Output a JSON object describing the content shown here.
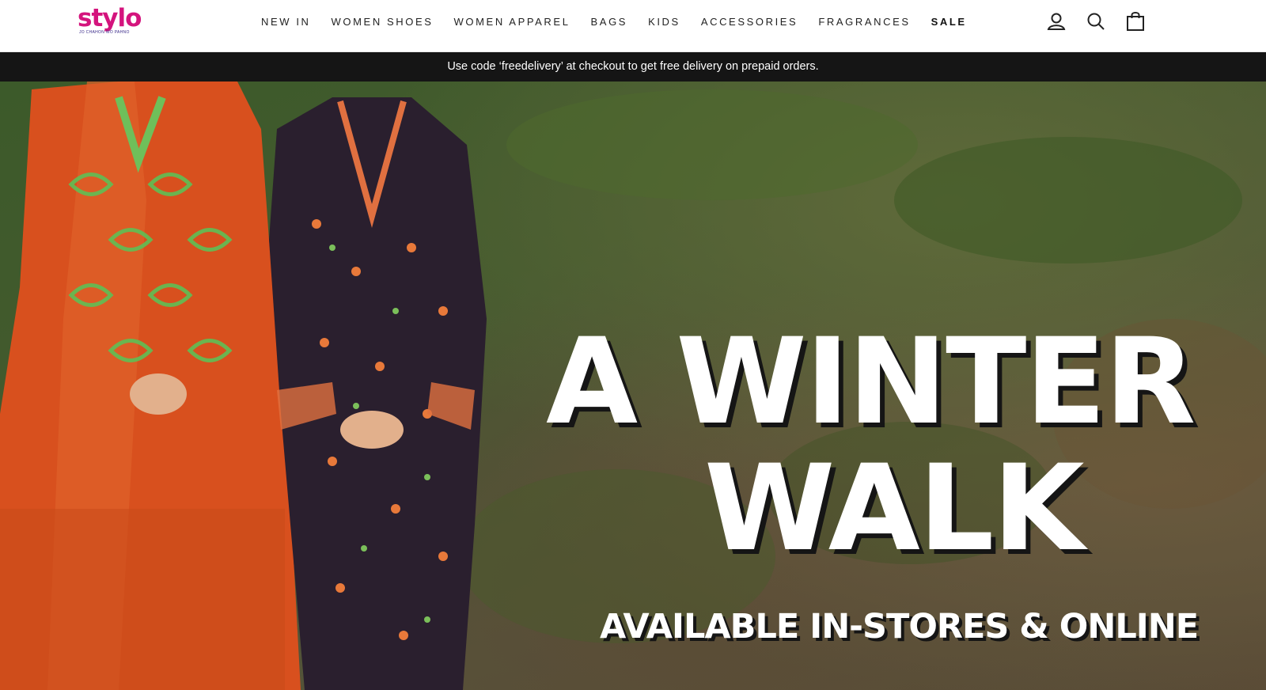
{
  "brand": {
    "name": "stylo",
    "tagline": "JO CHAHON WO PAHNO",
    "color": "#d4147d",
    "color_accent": "#3a2a8a"
  },
  "nav": {
    "items": [
      {
        "label": "NEW IN"
      },
      {
        "label": "WOMEN SHOES"
      },
      {
        "label": "WOMEN APPAREL"
      },
      {
        "label": "BAGS"
      },
      {
        "label": "KIDS"
      },
      {
        "label": "ACCESSORIES"
      },
      {
        "label": "FRAGRANCES"
      },
      {
        "label": "SALE"
      }
    ]
  },
  "header_icons": {
    "account": "user-icon",
    "search": "search-icon",
    "cart": "shopping-bag-icon"
  },
  "promo": {
    "text": "Use code ‘freedelivery’ at checkout to get free delivery on prepaid orders."
  },
  "hero": {
    "title_line1": "A WINTER",
    "title_line2": "WALK",
    "subtitle": "AVAILABLE IN-STORES & ONLINE"
  }
}
